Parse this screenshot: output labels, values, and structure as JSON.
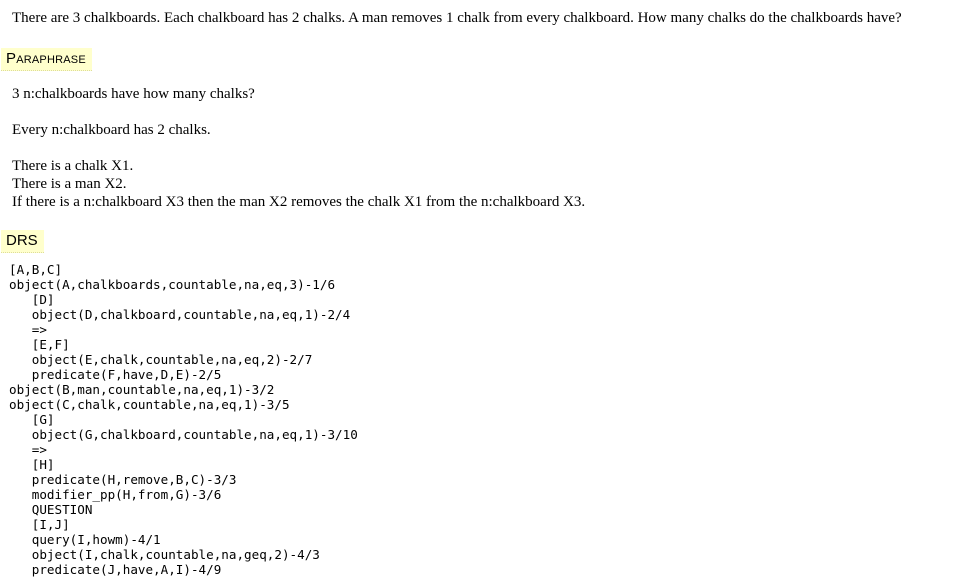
{
  "problem": "There are 3 chalkboards. Each chalkboard has 2 chalks. A man removes 1 chalk from every chalkboard. How many chalks do the chalkboards have?",
  "paraphrase": {
    "label": "Paraphrase",
    "lines": [
      "3 n:chalkboards have how many chalks?",
      "Every n:chalkboard has 2 chalks.",
      "There is a chalk X1.",
      "There is a man X2.",
      "If there is a n:chalkboard X3 then the man X2 removes the chalk X1 from the n:chalkboard X3."
    ]
  },
  "drs": {
    "label": "DRS",
    "lines": [
      "[A,B,C]",
      "object(A,chalkboards,countable,na,eq,3)-1/6",
      "   [D]",
      "   object(D,chalkboard,countable,na,eq,1)-2/4",
      "   =>",
      "   [E,F]",
      "   object(E,chalk,countable,na,eq,2)-2/7",
      "   predicate(F,have,D,E)-2/5",
      "object(B,man,countable,na,eq,1)-3/2",
      "object(C,chalk,countable,na,eq,1)-3/5",
      "   [G]",
      "   object(G,chalkboard,countable,na,eq,1)-3/10",
      "   =>",
      "   [H]",
      "   predicate(H,remove,B,C)-3/3",
      "   modifier_pp(H,from,G)-3/6",
      "   QUESTION",
      "   [I,J]",
      "   query(I,howm)-4/1",
      "   object(I,chalk,countable,na,geq,2)-4/3",
      "   predicate(J,have,A,I)-4/9"
    ]
  }
}
